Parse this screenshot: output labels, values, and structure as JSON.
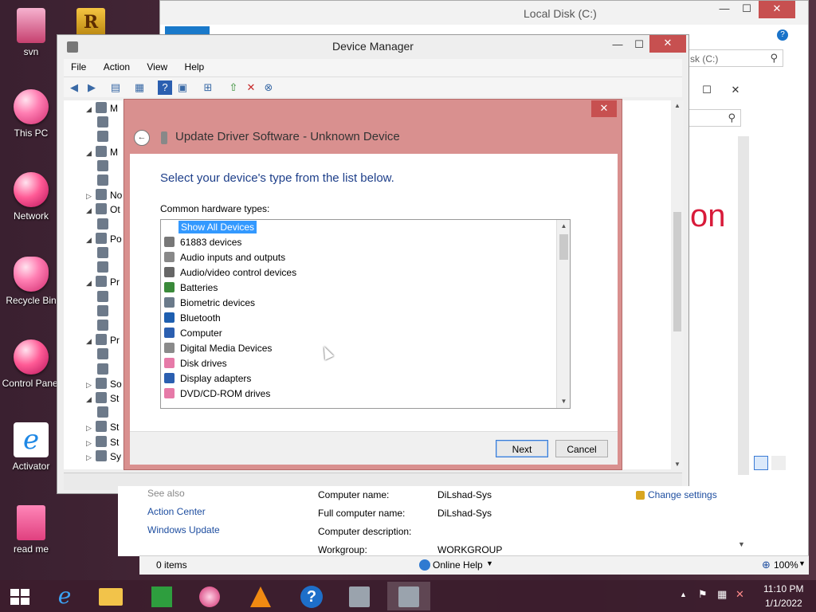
{
  "desktop_icons": [
    {
      "label": "svn"
    },
    {
      "label": "This PC"
    },
    {
      "label": "Network"
    },
    {
      "label": "Recycle Bin"
    },
    {
      "label": "Control Panel"
    },
    {
      "label": "Activator"
    },
    {
      "label": "read me"
    }
  ],
  "bg_explorer": {
    "title": "Local Disk (C:)",
    "search_placeholder": "sk (C:)",
    "partial_text": "on"
  },
  "device_manager": {
    "title": "Device Manager",
    "menu": [
      "File",
      "Action",
      "View",
      "Help"
    ],
    "tree_rows": [
      "M",
      "",
      "",
      "M",
      "",
      "",
      "No",
      "Ot",
      "",
      "Po",
      "",
      "",
      "Pr",
      "",
      "",
      "",
      "Pr",
      "",
      "",
      "So",
      "St",
      "",
      "St",
      "St",
      "Sy"
    ]
  },
  "dialog": {
    "title": "Update Driver Software - Unknown Device",
    "instruction": "Select your device's type from the list below.",
    "list_label": "Common hardware types:",
    "items": [
      "Show All Devices",
      "61883 devices",
      "Audio inputs and outputs",
      "Audio/video control devices",
      "Batteries",
      "Biometric devices",
      "Bluetooth",
      "Computer",
      "Digital Media Devices",
      "Disk drives",
      "Display adapters",
      "DVD/CD-ROM drives"
    ],
    "next_label": "Next",
    "cancel_label": "Cancel"
  },
  "system_info": {
    "see_also": "See also",
    "links": [
      "Action Center",
      "Windows Update"
    ],
    "change_settings": "Change settings",
    "rows": [
      {
        "key": "Computer name:",
        "value": "DiLshad-Sys"
      },
      {
        "key": "Full computer name:",
        "value": "DiLshad-Sys"
      },
      {
        "key": "Computer description:",
        "value": ""
      },
      {
        "key": "Workgroup:",
        "value": "WORKGROUP"
      }
    ]
  },
  "explorer_status": {
    "items": "0 items",
    "online_help": "Online Help",
    "zoom": "100%"
  },
  "taskbar": {
    "time": "11:10 PM",
    "date": "1/1/2022"
  },
  "colors": {
    "dialog_frame": "#d9908f",
    "instruction_blue": "#1e3f8a",
    "selection": "#3399ff",
    "close_red": "#c75050"
  }
}
